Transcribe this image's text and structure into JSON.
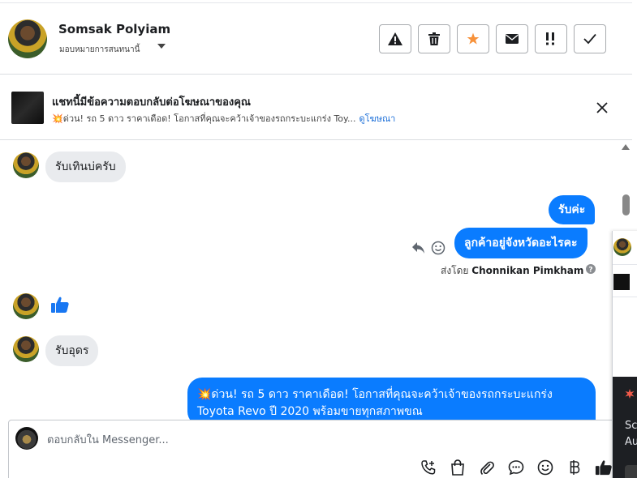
{
  "header": {
    "name": "Somsak Polyiam",
    "assign_label": "มอบหมายการสนทนานี้",
    "buttons": [
      {
        "name": "report-button",
        "icon": "warning-icon"
      },
      {
        "name": "delete-button",
        "icon": "trash-icon"
      },
      {
        "name": "star-button",
        "icon": "star-icon"
      },
      {
        "name": "mark-unread-button",
        "icon": "envelope-icon"
      },
      {
        "name": "follow-up-button",
        "icon": "exclamation-icon"
      },
      {
        "name": "mark-done-button",
        "icon": "check-icon"
      }
    ]
  },
  "ad": {
    "title": "แชทนี้มีข้อความตอบกลับต่อโฆษณาของคุณ",
    "preview": "💥ด่วน! รถ 5 ดาว ราคาเดือด! โอกาสที่คุณจะคว้าเจ้าของรถกระบะแกร่ง Toy...",
    "view_ad": "ดูโฆษณา"
  },
  "messages": [
    {
      "dir": "in",
      "text": "รับเทินบ่ครับ"
    },
    {
      "dir": "out",
      "text": "รับค่ะ"
    },
    {
      "dir": "out",
      "text": "ลูกค้าอยู่จังหวัดอะไรคะ"
    },
    {
      "dir": "in",
      "text": "👍"
    },
    {
      "dir": "in",
      "text": "รับอุดร"
    },
    {
      "dir": "out",
      "text": "💥ด่วน! รถ 5 ดาว ราคาเดือด! โอกาสที่คุณจะคว้าเจ้าของรถกระบะแกร่ง",
      "text2": "Toyota Revo ปี 2020 พร้อมขายทุกสภาพขณ"
    }
  ],
  "sent_by": {
    "prefix": "ส่งโดย",
    "name": "Chonnikan Pimkham"
  },
  "composer": {
    "placeholder": "ตอบกลับใน Messenger..."
  },
  "side_panel": {
    "text_a": "Sc",
    "text_b": "Au"
  },
  "colors": {
    "accent": "#0a7cff",
    "star": "#f7923b",
    "link": "#1a6ed8"
  }
}
